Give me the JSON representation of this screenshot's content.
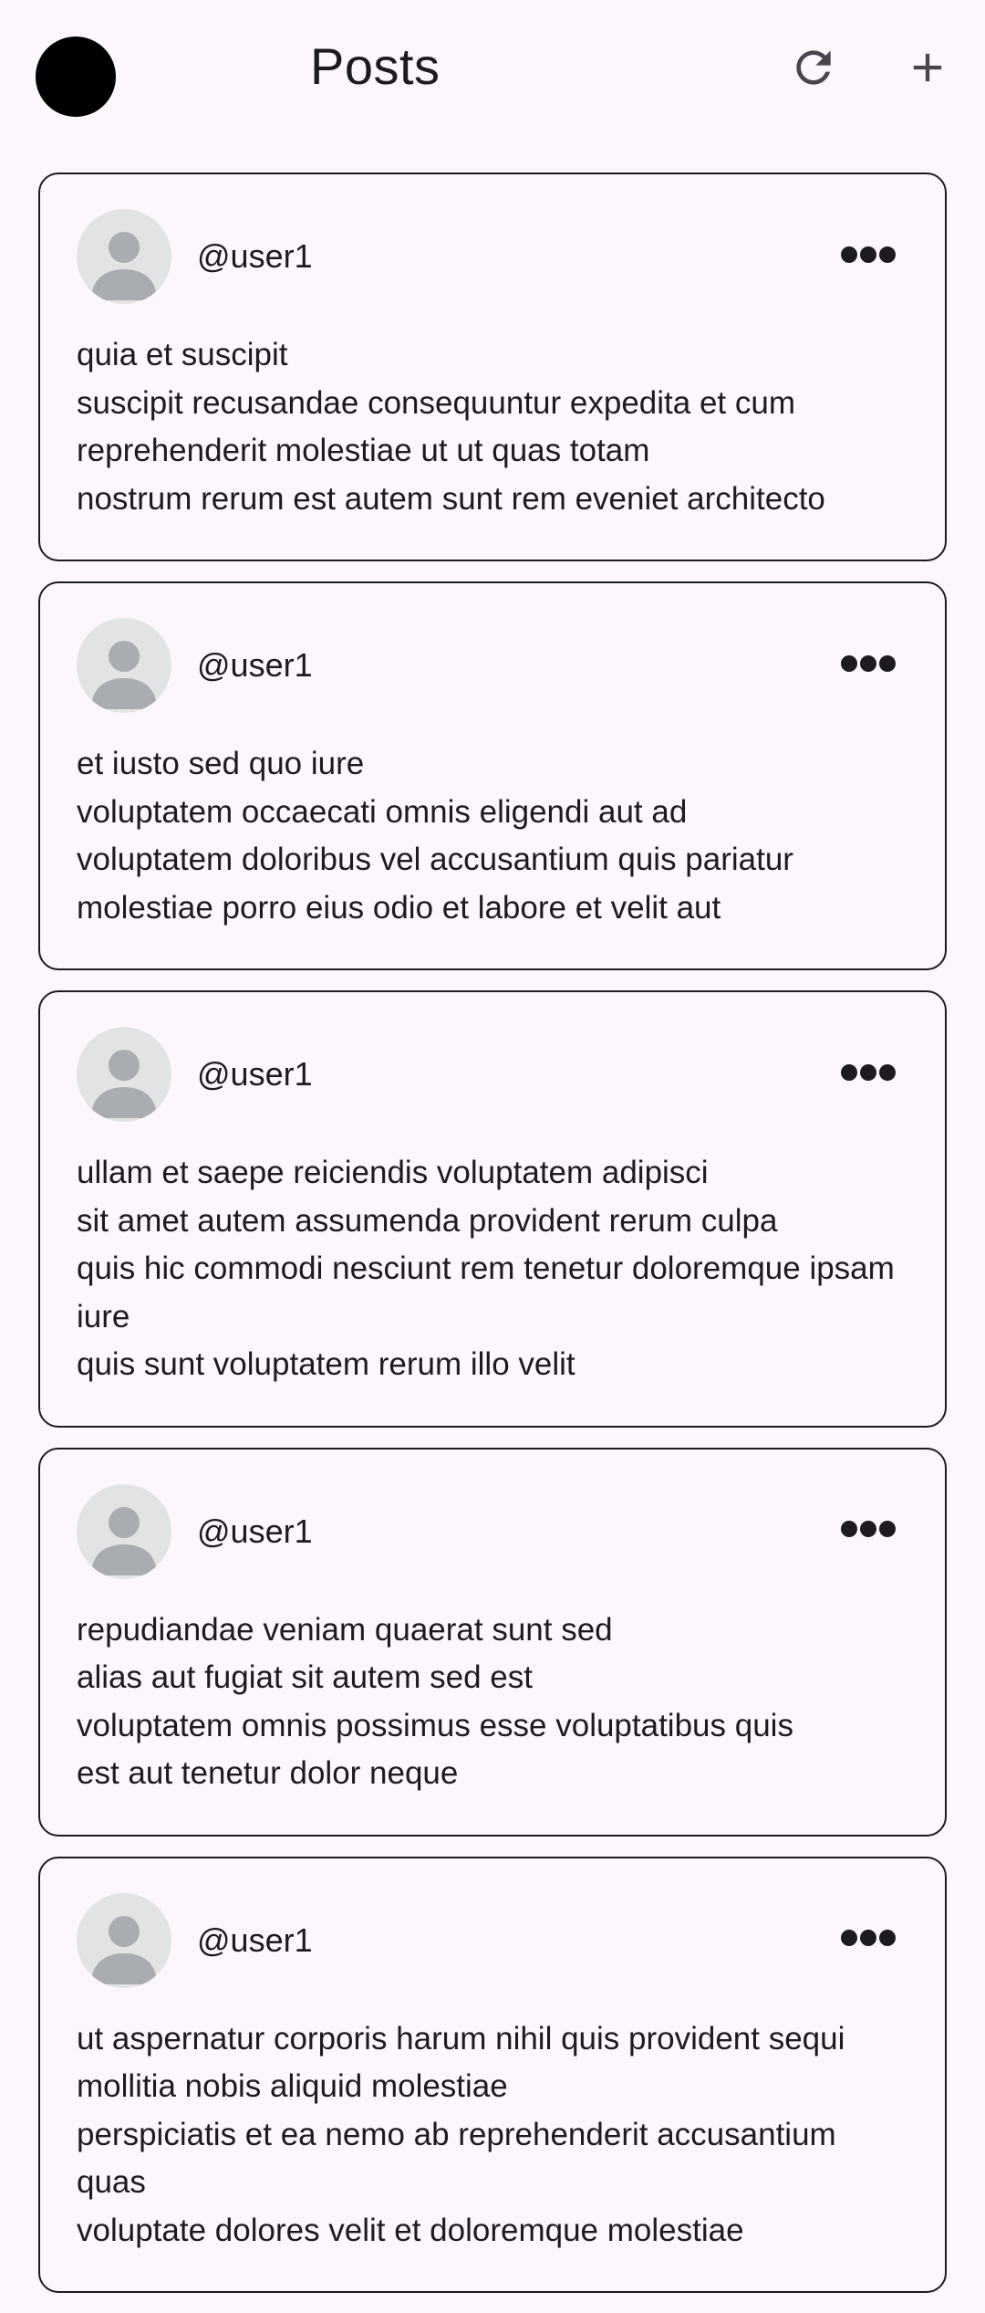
{
  "app_bar": {
    "title": "Posts",
    "avatar_color": "#000000",
    "actions": [
      {
        "icon": "refresh-icon"
      },
      {
        "icon": "add-icon"
      }
    ]
  },
  "posts": [
    {
      "username": "@user1",
      "avatar_icon": "person-icon",
      "menu_icon": "more-horiz-icon",
      "body": "quia et suscipit\nsuscipit recusandae consequuntur expedita et cum\nreprehenderit molestiae ut ut quas totam\nnostrum rerum est autem sunt rem eveniet architecto"
    },
    {
      "username": "@user1",
      "avatar_icon": "person-icon",
      "menu_icon": "more-horiz-icon",
      "body": "et iusto sed quo iure\nvoluptatem occaecati omnis eligendi aut ad\nvoluptatem doloribus vel accusantium quis pariatur\nmolestiae porro eius odio et labore et velit aut"
    },
    {
      "username": "@user1",
      "avatar_icon": "person-icon",
      "menu_icon": "more-horiz-icon",
      "body": "ullam et saepe reiciendis voluptatem adipisci\nsit amet autem assumenda provident rerum culpa\nquis hic commodi nesciunt rem tenetur doloremque ipsam iure\nquis sunt voluptatem rerum illo velit"
    },
    {
      "username": "@user1",
      "avatar_icon": "person-icon",
      "menu_icon": "more-horiz-icon",
      "body": "repudiandae veniam quaerat sunt sed\nalias aut fugiat sit autem sed est\nvoluptatem omnis possimus esse voluptatibus quis\nest aut tenetur dolor neque"
    },
    {
      "username": "@user1",
      "avatar_icon": "person-icon",
      "menu_icon": "more-horiz-icon",
      "body": "ut aspernatur corporis harum nihil quis provident sequi\nmollitia nobis aliquid molestiae\nperspiciatis et ea nemo ab reprehenderit accusantium quas\nvoluptate dolores velit et doloremque molestiae"
    }
  ],
  "colors": {
    "background": "#fdf7fd",
    "text": "#1d1b20",
    "card_border": "#1d1b20",
    "avatar_bg": "#e2e3e5",
    "avatar_fg": "#a9adb1"
  }
}
